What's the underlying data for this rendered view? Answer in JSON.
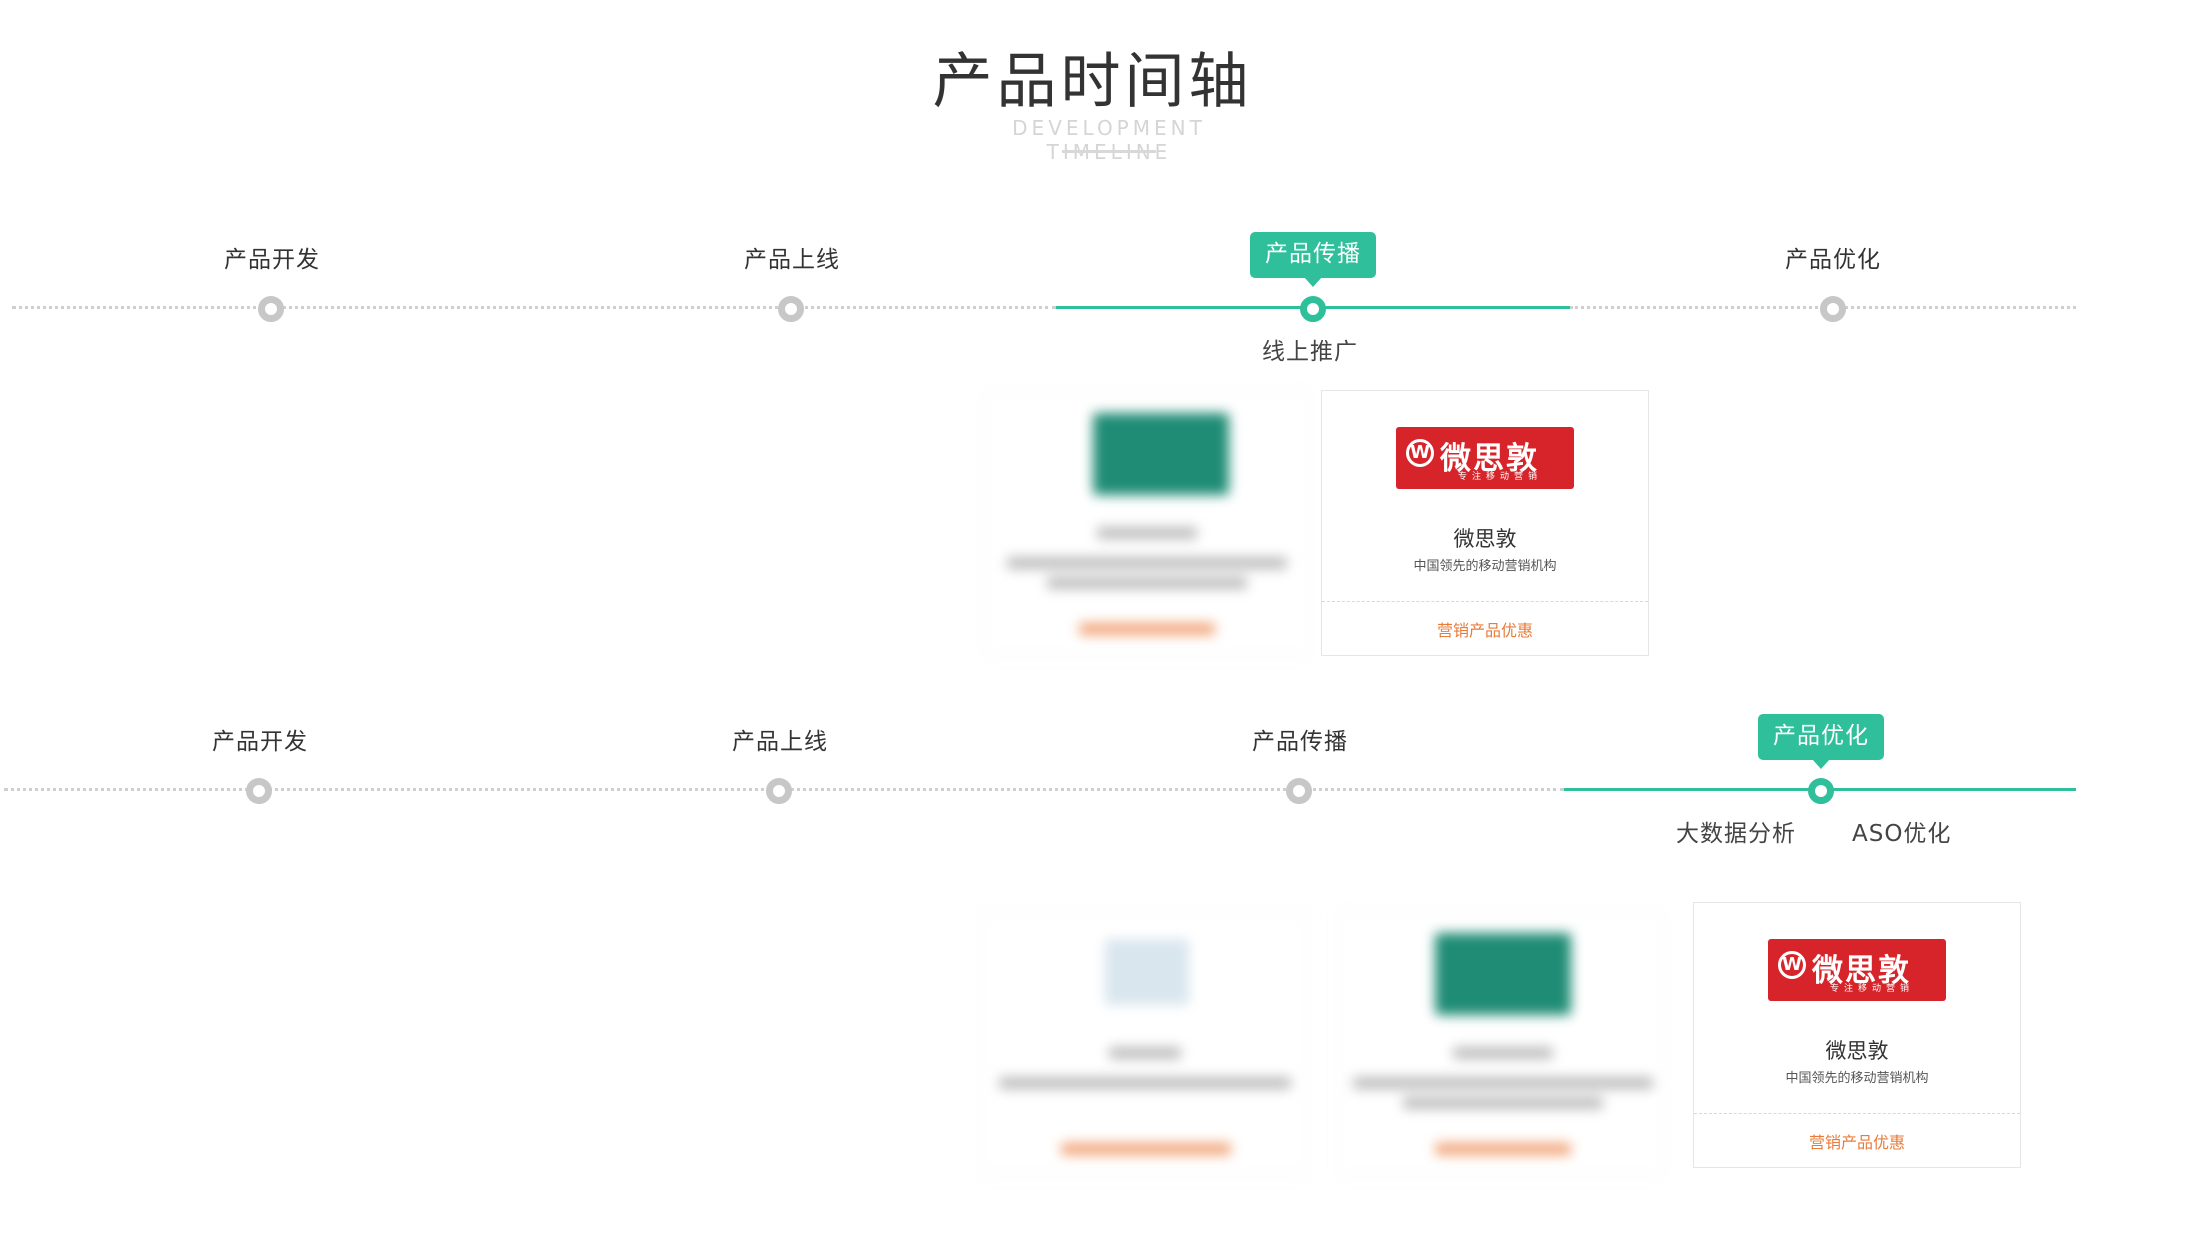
{
  "header": {
    "title": "产品时间轴",
    "subtitle": "DEVELOPMENT TIMELINE"
  },
  "colors": {
    "accent": "#2fbf9a",
    "node_inactive": "#c7c7c7",
    "brand_red": "#d7242b",
    "link_orange": "#e97b3a"
  },
  "timeline1": {
    "stages": [
      "产品开发",
      "产品上线",
      "产品传播",
      "产品优化"
    ],
    "active_stage": "产品传播",
    "sub_items": [
      "线上推广"
    ],
    "cards": [
      {
        "name": "",
        "desc": "",
        "link": "",
        "blurred": true
      },
      {
        "name": "微思敦",
        "desc": "中国领先的移动营销机构",
        "link": "营销产品优惠",
        "logo_text": "微思敦",
        "logo_sub": "专注移动营销",
        "blurred": false
      }
    ]
  },
  "timeline2": {
    "stages": [
      "产品开发",
      "产品上线",
      "产品传播",
      "产品优化"
    ],
    "active_stage": "产品优化",
    "sub_items": [
      "大数据分析",
      "ASO优化"
    ],
    "cards": [
      {
        "name": "",
        "desc": "",
        "link": "",
        "blurred": true
      },
      {
        "name": "",
        "desc": "",
        "link": "",
        "blurred": true
      },
      {
        "name": "微思敦",
        "desc": "中国领先的移动营销机构",
        "link": "营销产品优惠",
        "logo_text": "微思敦",
        "logo_sub": "专注移动营销",
        "blurred": false
      }
    ]
  }
}
